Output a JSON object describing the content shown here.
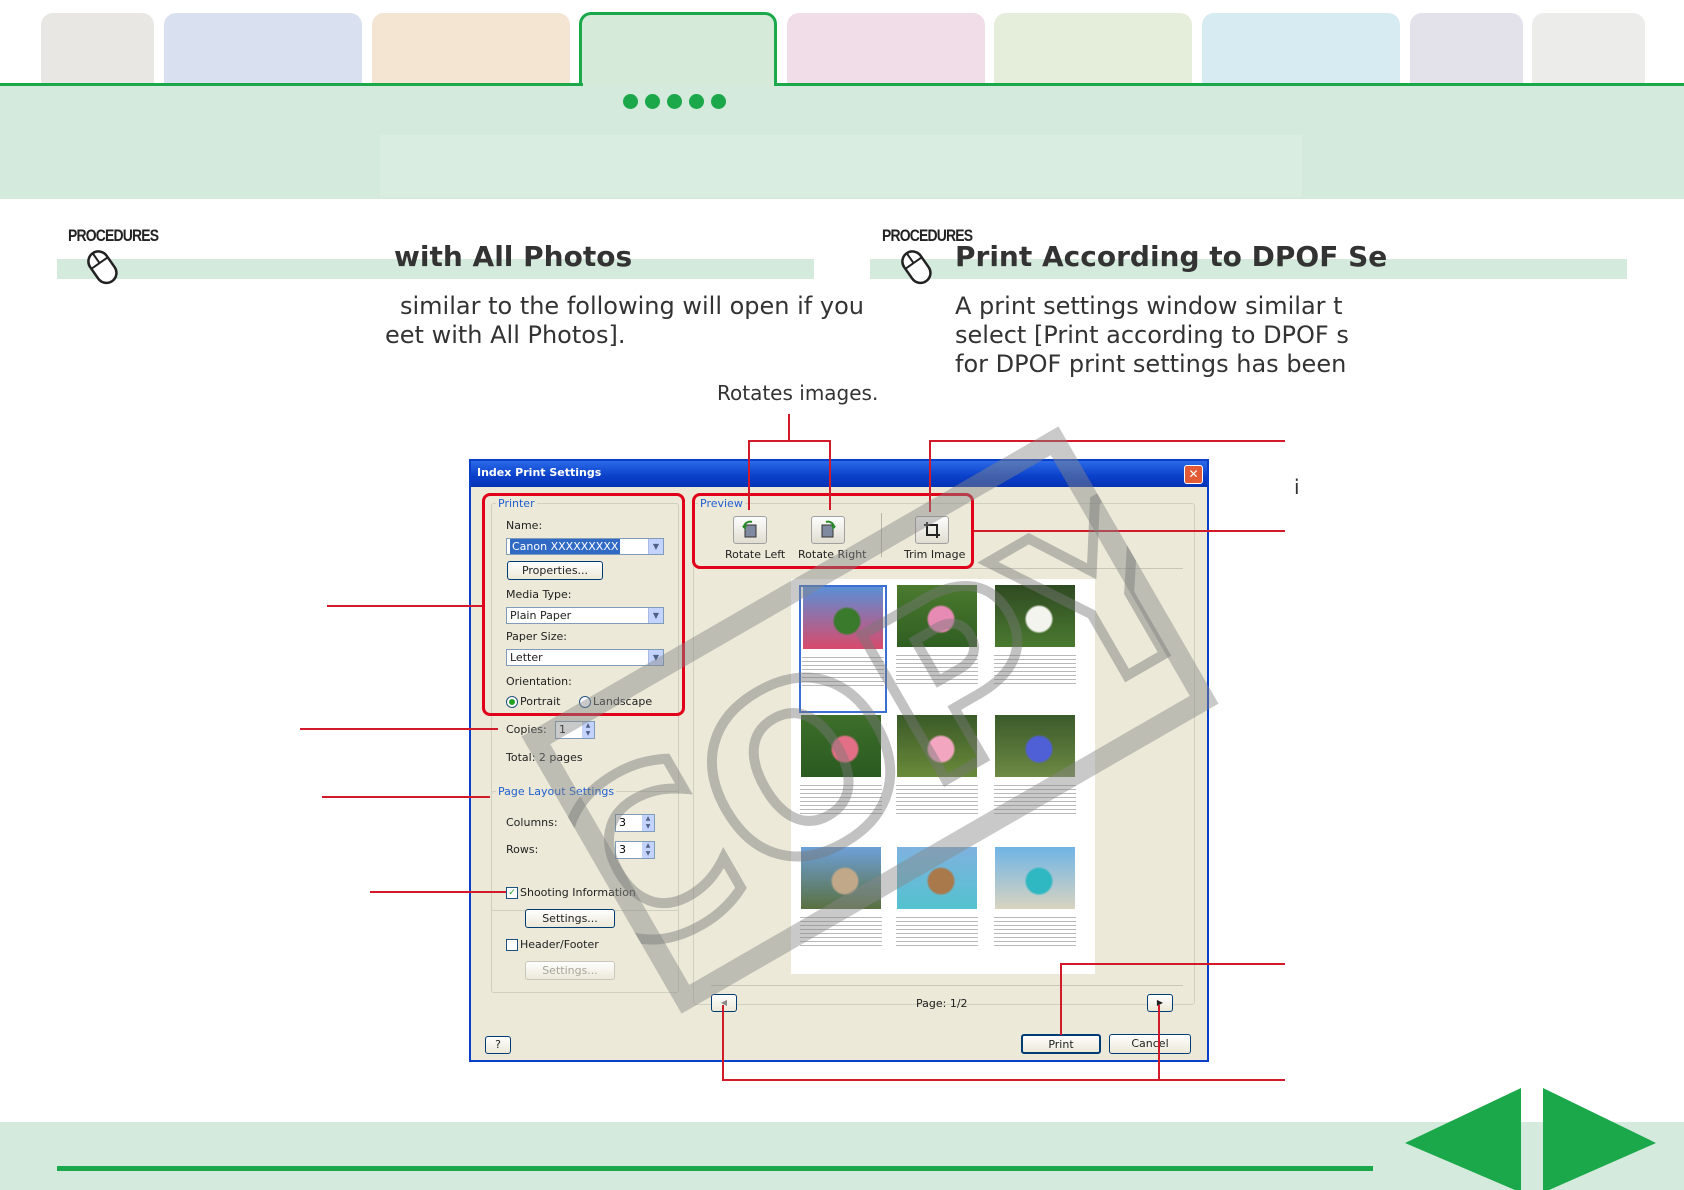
{
  "tabs": [
    {
      "color": "#e8e7e3"
    },
    {
      "color": "#d9e0ef"
    },
    {
      "color": "#f4e4d2"
    },
    {
      "color": "#d6ead9",
      "active": true
    },
    {
      "color": "#f0dde8"
    },
    {
      "color": "#e4eedb"
    },
    {
      "color": "#d6ecf2"
    },
    {
      "color": "#e3e1ea"
    },
    {
      "color": "#ececea"
    }
  ],
  "left_section": {
    "procedures_label": "PROCEDURES",
    "heading": "with All Photos",
    "body_line1": "similar to the following will open if you",
    "body_line2": "eet with All Photos]."
  },
  "right_section": {
    "procedures_label": "PROCEDURES",
    "heading": "Print According to DPOF Se",
    "body_line1": "A print settings window similar t",
    "body_line2": "select [Print according to DPOF s",
    "body_line3": "for DPOF print settings has been"
  },
  "callouts": {
    "rotates_images": "Rotates images.",
    "stray_i": "i"
  },
  "dialog": {
    "title": "Index Print Settings",
    "close": "✕",
    "printer_group": "Printer",
    "name_label": "Name:",
    "name_value": "Canon XXXXXXXXX",
    "properties_button": "Properties...",
    "media_type_label": "Media Type:",
    "media_type_value": "Plain Paper",
    "paper_size_label": "Paper Size:",
    "paper_size_value": "Letter",
    "orientation_label": "Orientation:",
    "portrait": "Portrait",
    "landscape": "Landscape",
    "copies_label": "Copies:",
    "copies_value": "1",
    "total_pages": "Total: 2 pages",
    "page_layout_group": "Page Layout Settings",
    "columns_label": "Columns:",
    "columns_value": "3",
    "rows_label": "Rows:",
    "rows_value": "3",
    "shooting_info": "Shooting Information",
    "settings_button": "Settings...",
    "header_footer": "Header/Footer",
    "settings_button_disabled": "Settings...",
    "preview_group": "Preview",
    "rotate_left": "Rotate Left",
    "rotate_right": "Rotate Right",
    "trim_image": "Trim Image",
    "page_indicator": "Page: 1/2",
    "help_button": "?",
    "print_button": "Print",
    "cancel_button": "Cancel",
    "prev_icon": "◀",
    "next_icon": "▶"
  },
  "thumbnails": [
    {
      "colors": [
        "#5b8fd6",
        "#3a7a2c",
        "#d94a6b"
      ]
    },
    {
      "colors": [
        "#4b7a2e",
        "#e88bb4",
        "#2f5e22"
      ]
    },
    {
      "colors": [
        "#2f4a22",
        "#f4f4ee",
        "#4a7a30"
      ]
    },
    {
      "colors": [
        "#3e6e2a",
        "#e36f86",
        "#2a5a20"
      ]
    },
    {
      "colors": [
        "#3a5a28",
        "#f2a6c0",
        "#6a8a3a"
      ]
    },
    {
      "colors": [
        "#3a5a2a",
        "#4f5fd6",
        "#6e8a45"
      ]
    },
    {
      "colors": [
        "#6ea0d8",
        "#c0a888",
        "#5a7040"
      ]
    },
    {
      "colors": [
        "#7fb2df",
        "#a9784b",
        "#53c2cf"
      ]
    },
    {
      "colors": [
        "#6fb4e6",
        "#2fb7c2",
        "#d9d4c0"
      ]
    }
  ],
  "watermark_text": "COPY"
}
